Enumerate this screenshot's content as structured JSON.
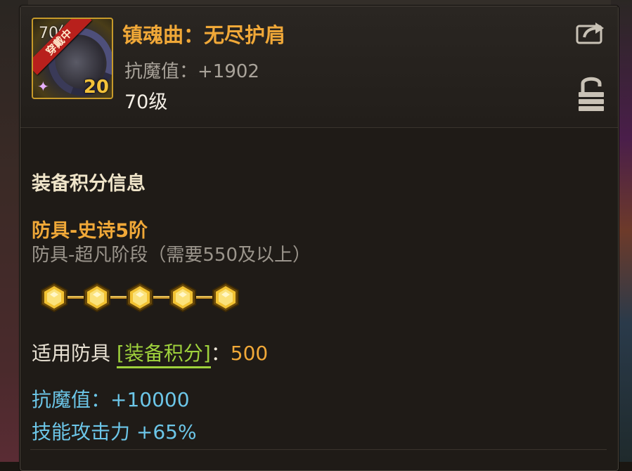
{
  "item": {
    "name": "镇魂曲：无尽护肩",
    "stat_line": "抗魔值：+1902",
    "level": "70级",
    "icon_level_text": "70级",
    "equipped_badge": "穿戴中",
    "enhance_level": "20",
    "icon": "shoulder-armor-icon"
  },
  "header_icons": {
    "share": "share-icon",
    "lock": "lock-open-icon"
  },
  "score_info": {
    "title": "装备积分信息",
    "grade": "防具-史诗5阶",
    "next_grade": "防具-超凡阶段（需要550及以上）",
    "stars": 5,
    "applied_prefix": "适用防具 ",
    "applied_link": "[装备积分]",
    "applied_sep": "：",
    "applied_value": "500",
    "bonus_1": "抗魔值：+10000",
    "bonus_2": "技能攻击力 +65%"
  },
  "colors": {
    "name_orange": "#f0a838",
    "bonus_blue": "#6cc6e8",
    "link_green": "#9fd23c",
    "icon_border_gold": "#c79a2a"
  }
}
